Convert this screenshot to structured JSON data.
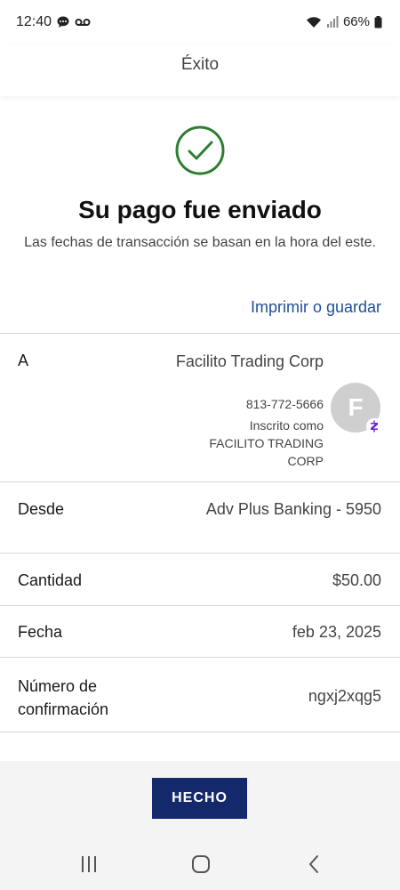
{
  "status_bar": {
    "time": "12:40",
    "battery": "66%"
  },
  "header": {
    "title": "Éxito"
  },
  "confirmation": {
    "title": "Su pago fue enviado",
    "subtitle": "Las fechas de transacción se basan en la hora del este.",
    "print_link": "Imprimir o guardar"
  },
  "details": {
    "to": {
      "label": "A",
      "name": "Facilito Trading Corp",
      "phone": "813-772-5666",
      "enrolled_label": "Inscrito como",
      "enrolled_name": "FACILITO TRADING CORP",
      "avatar_initial": "F"
    },
    "from": {
      "label": "Desde",
      "value": "Adv Plus Banking - 5950"
    },
    "amount": {
      "label": "Cantidad",
      "value": "$50.00"
    },
    "date": {
      "label": "Fecha",
      "value": "feb 23, 2025"
    },
    "confirmation_number": {
      "label_line1": "Número de",
      "label_line2": "confirmación",
      "value": "ngxj2xqg5"
    }
  },
  "actions": {
    "done_label": "HECHO"
  },
  "colors": {
    "accent": "#1f4f99",
    "button": "#13296b",
    "success": "#2e7d32"
  }
}
